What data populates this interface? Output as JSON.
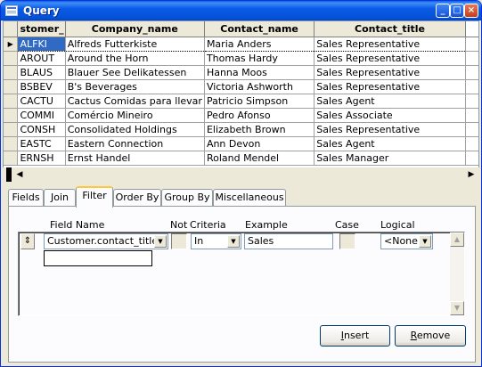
{
  "window": {
    "title": "Query",
    "controls": {
      "minimize": "_",
      "maximize": "□",
      "close": "×"
    }
  },
  "grid": {
    "columns": [
      "stomer_",
      "Company_name",
      "Contact_name",
      "Contact_title"
    ],
    "rows": [
      [
        "ALFKI",
        "Alfreds Futterkiste",
        "Maria Anders",
        "Sales Representative"
      ],
      [
        "AROUT",
        "Around the Horn",
        "Thomas Hardy",
        "Sales Representative"
      ],
      [
        "BLAUS",
        "Blauer See Delikatessen",
        "Hanna Moos",
        "Sales Representative"
      ],
      [
        "BSBEV",
        "B's Beverages",
        "Victoria Ashworth",
        "Sales Representative"
      ],
      [
        "CACTU",
        "Cactus Comidas para llevar",
        "Patricio Simpson",
        "Sales Agent"
      ],
      [
        "COMMI",
        "Comércio Mineiro",
        "Pedro Afonso",
        "Sales Associate"
      ],
      [
        "CONSH",
        "Consolidated Holdings",
        "Elizabeth Brown",
        "Sales Representative"
      ],
      [
        "EASTC",
        "Eastern Connection",
        "Ann Devon",
        "Sales Agent"
      ],
      [
        "ERNSH",
        "Ernst Handel",
        "Roland Mendel",
        "Sales Manager"
      ]
    ],
    "current_row_marker": "▶"
  },
  "tabs": [
    "Fields",
    "Join",
    "Filter",
    "Order By",
    "Group By",
    "Miscellaneous"
  ],
  "active_tab": "Filter",
  "filter": {
    "headers": {
      "field_name": "Field Name",
      "not": "Not",
      "criteria": "Criteria",
      "example": "Example",
      "case": "Case",
      "logical": "Logical"
    },
    "row": {
      "field_name": "Customer.contact_title",
      "criteria": "In",
      "example": "Sales",
      "logical": "<None>"
    }
  },
  "buttons": {
    "insert": {
      "label_first": "I",
      "label_rest": "nsert"
    },
    "remove": {
      "label_first": "R",
      "label_rest": "emove"
    }
  },
  "colors": {
    "selection": "#316ac5",
    "titlebar": "#0a5fe8",
    "tab_highlight": "#ffc83c"
  }
}
